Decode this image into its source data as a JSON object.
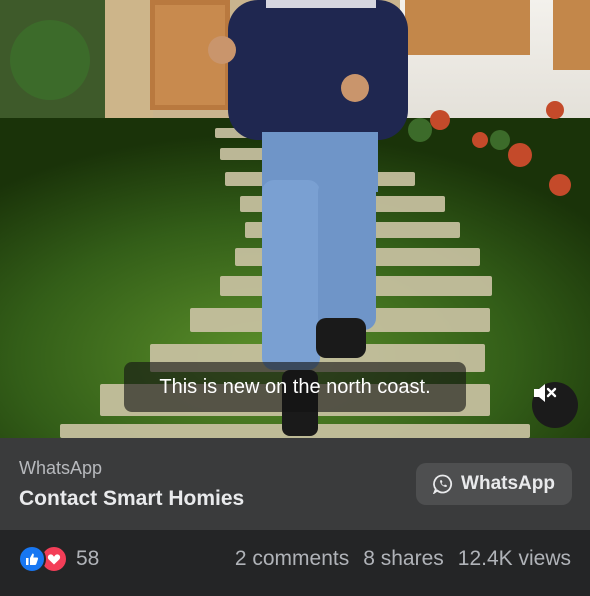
{
  "video": {
    "caption": "This is new on the north coast.",
    "mute_icon": "speaker-muted-icon"
  },
  "ad": {
    "source": "WhatsApp",
    "title": "Contact Smart Homies",
    "button_label": "WhatsApp",
    "button_icon": "whatsapp-icon"
  },
  "engagement": {
    "reaction_icons": [
      "like-icon",
      "love-icon"
    ],
    "reaction_count": "58",
    "comments": "2 comments",
    "shares": "8 shares",
    "views": "12.4K views"
  },
  "colors": {
    "like": "#1877f2",
    "love": "#f33e58",
    "panel": "#3a3b3c",
    "background": "#242526"
  }
}
